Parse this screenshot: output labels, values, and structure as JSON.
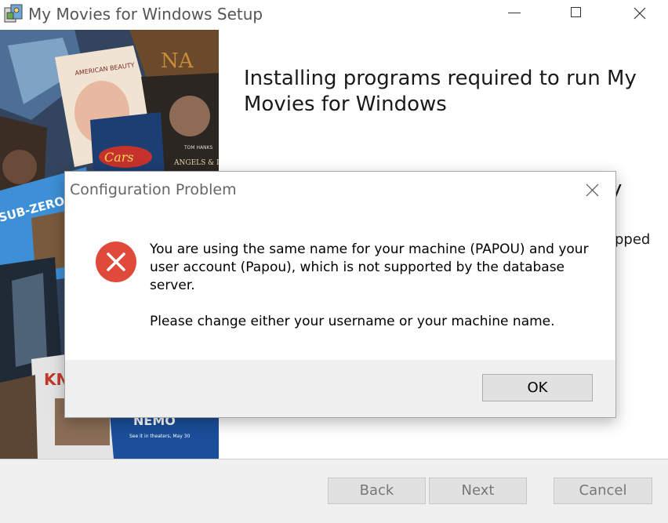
{
  "window": {
    "title": "My Movies for Windows Setup",
    "icons": {
      "app": "installer-icon",
      "minimize": "minimize-icon",
      "maximize": "maximize-icon",
      "close": "close-icon"
    }
  },
  "main": {
    "heading": "Installing programs required to run My Movies for Windows",
    "partial_right_text": "pped",
    "partial_right_char": "y"
  },
  "wizard_buttons": {
    "back": "Back",
    "next": "Next",
    "cancel": "Cancel"
  },
  "dialog": {
    "title": "Configuration Problem",
    "icon": "error-icon",
    "message_line1": "You are using the same name for your machine (PAPOU) and your user account (Papou), which is not supported by the database server.",
    "message_line2": "Please change either your username or your machine name.",
    "ok_label": "OK"
  },
  "collage": {
    "poster_texts": [
      "AMERICAN BEAUTY",
      "NA",
      "TOM HANKS",
      "ANGELS & DEMONS",
      "Cars",
      "SUB-ZERO HEROES",
      "KN",
      "NEMO",
      "See it in theaters, May 30"
    ]
  },
  "colors": {
    "error_red": "#e04a3a",
    "dialog_footer": "#f0f0f0",
    "button_face": "#e1e1e1"
  }
}
